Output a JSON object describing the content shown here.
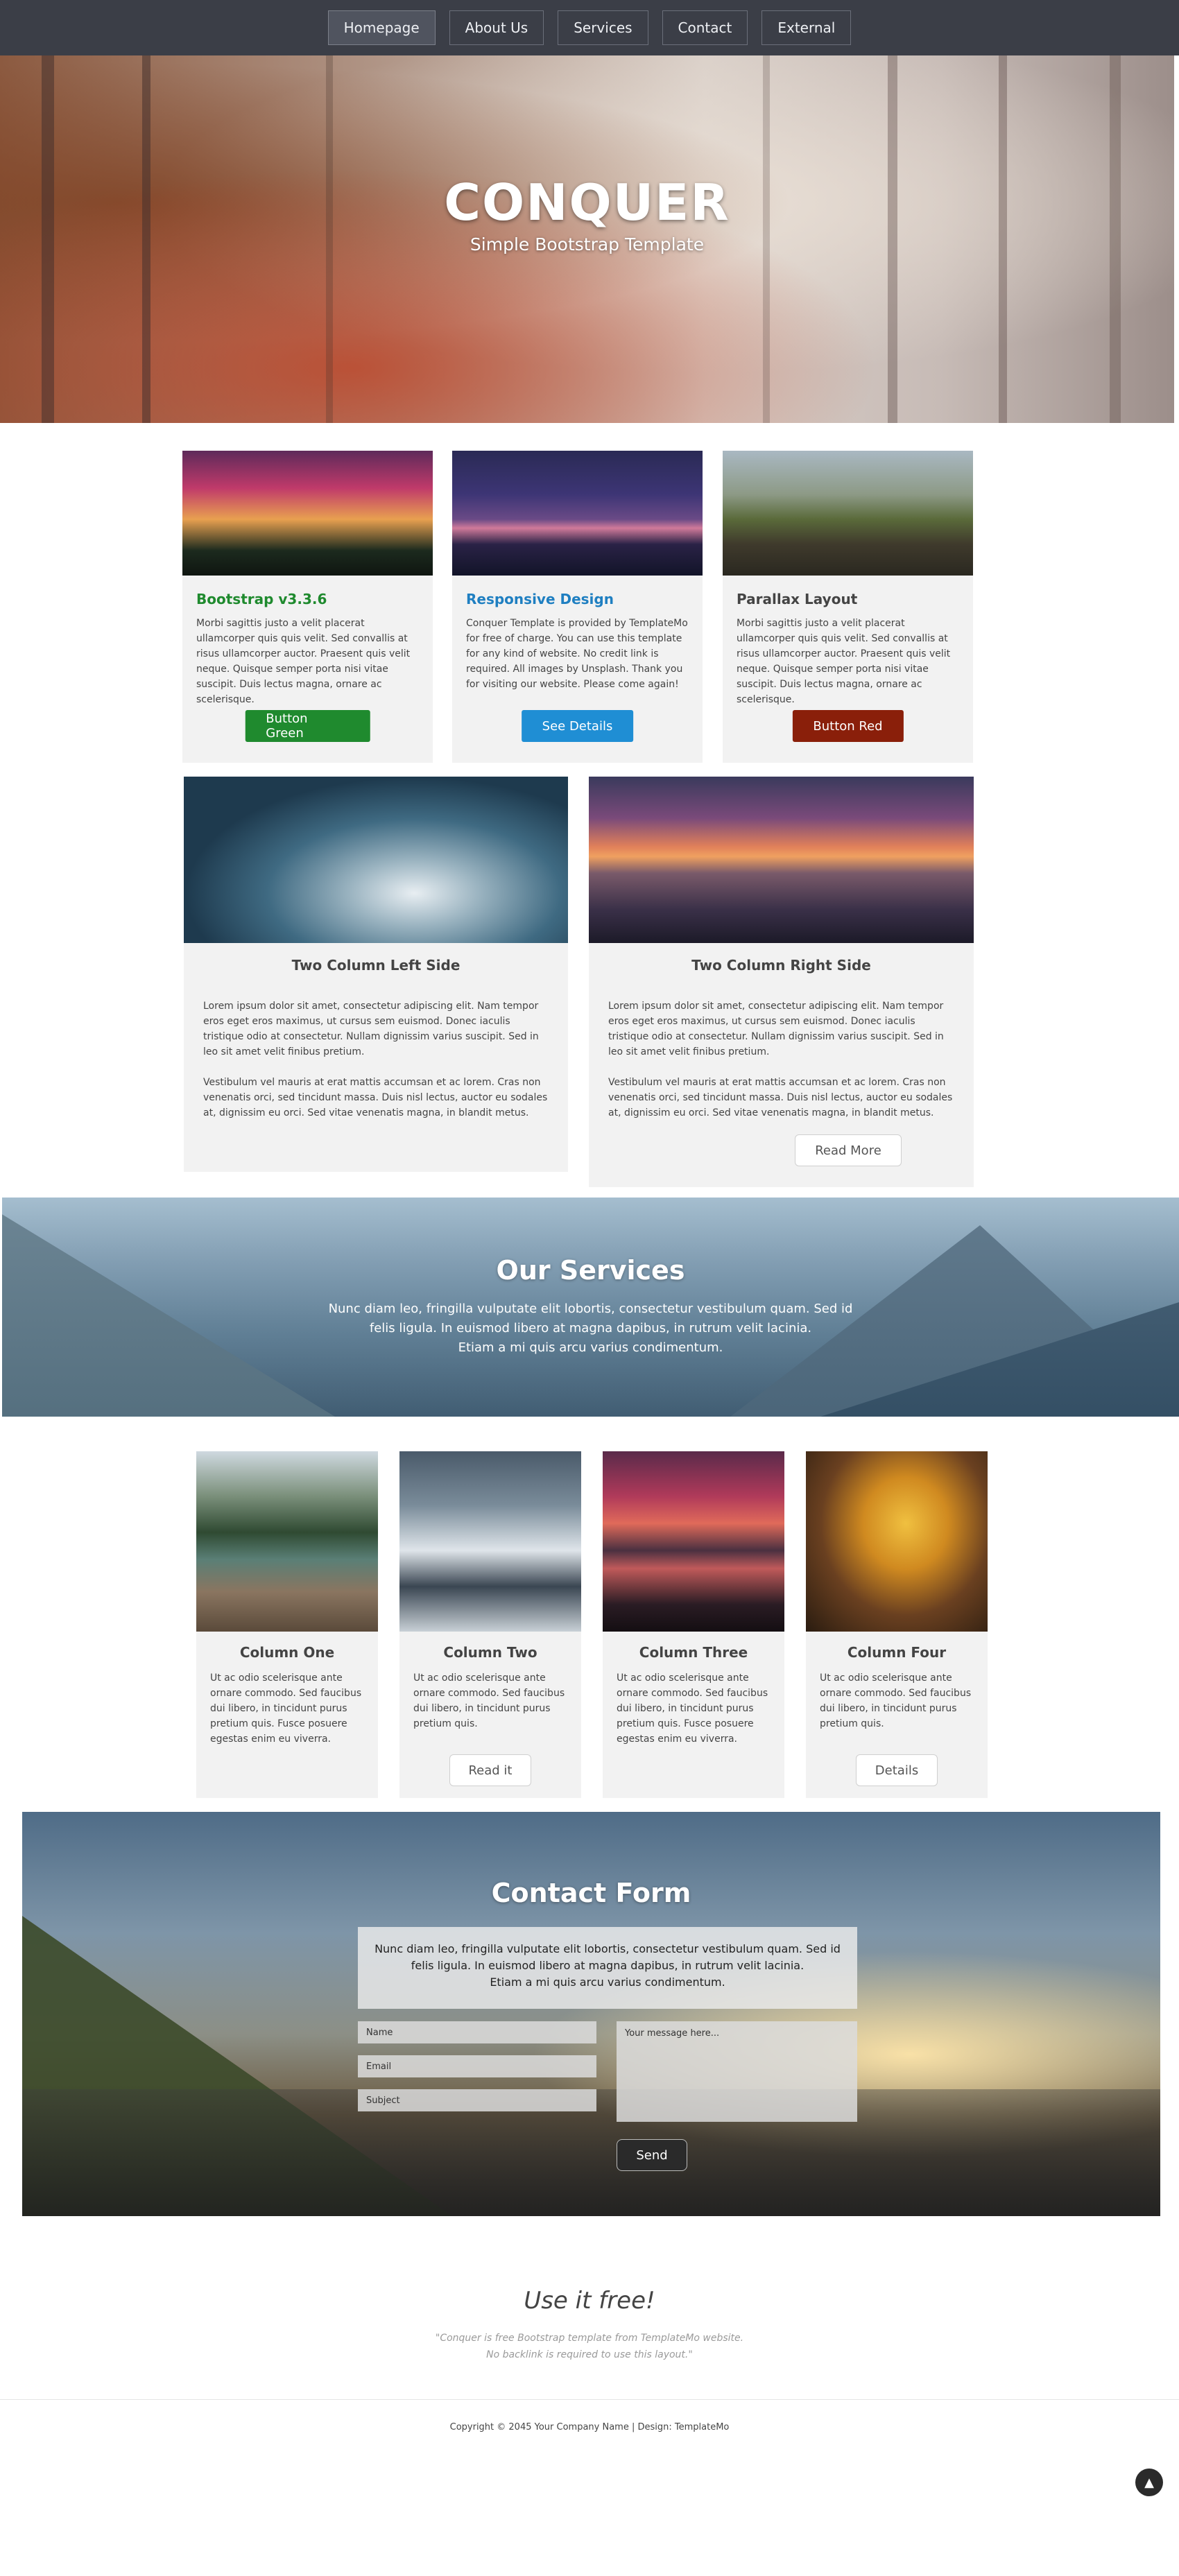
{
  "nav": {
    "items": [
      {
        "label": "Homepage",
        "active": true
      },
      {
        "label": "About Us"
      },
      {
        "label": "Services"
      },
      {
        "label": "Contact"
      },
      {
        "label": "External"
      }
    ]
  },
  "hero": {
    "title": "CONQUER",
    "subtitle": "Simple Bootstrap Template"
  },
  "cards": [
    {
      "title": "Bootstrap v3.3.6",
      "title_color": "#1f8a2e",
      "text": "Morbi sagittis justo a velit placerat ullamcorper quis quis velit. Sed convallis at risus ullamcorper auctor. Praesent quis velit neque. Quisque semper porta nisi vitae suscipit. Duis lectus magna, ornare ac scelerisque.",
      "button": "Button Green",
      "button_color": "#1f8a2e",
      "image": "aurora-pines-photo"
    },
    {
      "title": "Responsive Design",
      "title_color": "#1f7fc1",
      "text": "Conquer Template is provided by TemplateMo for free of charge. You can use this template for any kind of website. No credit link is required. All images by Unsplash. Thank you for visiting our website. Please come again!",
      "button": "See Details",
      "button_color": "#1f8ed4",
      "image": "city-bridge-photo"
    },
    {
      "title": "Parallax Layout",
      "title_color": "#444444",
      "text": "Morbi sagittis justo a velit placerat ullamcorper quis quis velit. Sed convallis at risus ullamcorper auctor. Praesent quis velit neque. Quisque semper porta nisi vitae suscipit. Duis lectus magna, ornare ac scelerisque.",
      "button": "Button Red",
      "button_color": "#8a1f0a",
      "image": "railway-bridge-photo"
    }
  ],
  "two_col": {
    "left": {
      "title": "Two Column Left Side",
      "p1": "Lorem ipsum dolor sit amet, consectetur adipiscing elit. Nam tempor eros eget eros maximus, ut cursus sem euismod. Donec iaculis tristique odio at consectetur. Nullam dignissim varius suscipit. Sed in leo sit amet velit finibus pretium.",
      "p2": "Vestibulum vel mauris at erat mattis accumsan et ac lorem. Cras non venenatis orci, sed tincidunt massa. Duis nisl lectus, auctor eu sodales at, dignissim eu orci. Sed vitae venenatis magna, in blandit metus."
    },
    "right": {
      "title": "Two Column Right Side",
      "p1": "Lorem ipsum dolor sit amet, consectetur adipiscing elit. Nam tempor eros eget eros maximus, ut cursus sem euismod. Donec iaculis tristique odio at consectetur. Nullam dignissim varius suscipit. Sed in leo sit amet velit finibus pretium.",
      "p2": "Vestibulum vel mauris at erat mattis accumsan et ac lorem. Cras non venenatis orci, sed tincidunt massa. Duis nisl lectus, auctor eu sodales at, dignissim eu orci. Sed vitae venenatis magna, in blandit metus.",
      "button": "Read More"
    }
  },
  "services": {
    "title": "Our Services",
    "line1": "Nunc diam leo, fringilla vulputate elit lobortis, consectetur vestibulum quam. Sed id",
    "line2": "felis ligula. In euismod libero at magna dapibus, in rutrum velit lacinia.",
    "line3": "Etiam a mi quis arcu varius condimentum."
  },
  "columns": [
    {
      "title": "Column One",
      "text": "Ut ac odio scelerisque ante ornare commodo. Sed faucibus dui libero, in tincidunt purus pretium quis. Fusce posuere egestas enim eu viverra.",
      "button": ""
    },
    {
      "title": "Column Two",
      "text": "Ut ac odio scelerisque ante ornare commodo. Sed faucibus dui libero, in tincidunt purus pretium quis.",
      "button": "Read it"
    },
    {
      "title": "Column Three",
      "text": "Ut ac odio scelerisque ante ornare commodo. Sed faucibus dui libero, in tincidunt purus pretium quis. Fusce posuere egestas enim eu viverra.",
      "button": ""
    },
    {
      "title": "Column Four",
      "text": "Ut ac odio scelerisque ante ornare commodo. Sed faucibus dui libero, in tincidunt purus pretium quis.",
      "button": "Details"
    }
  ],
  "contact": {
    "title": "Contact Form",
    "line1": "Nunc diam leo, fringilla vulputate elit lobortis, consectetur vestibulum quam. Sed id",
    "line2": "felis ligula. In euismod libero at magna dapibus, in rutrum velit lacinia.",
    "line3": "Etiam a mi quis arcu varius condimentum.",
    "name_placeholder": "Name",
    "email_placeholder": "Email",
    "subject_placeholder": "Subject",
    "message_placeholder": "Your message here...",
    "send": "Send"
  },
  "footer": {
    "heading": "Use it free!",
    "quote1": "\"Conquer is free Bootstrap template from TemplateMo website.",
    "quote2": "No backlink is required to use this layout.\"",
    "copyright": "Copyright © 2045 Your Company Name | Design: TemplateMo",
    "to_top": "▲"
  }
}
